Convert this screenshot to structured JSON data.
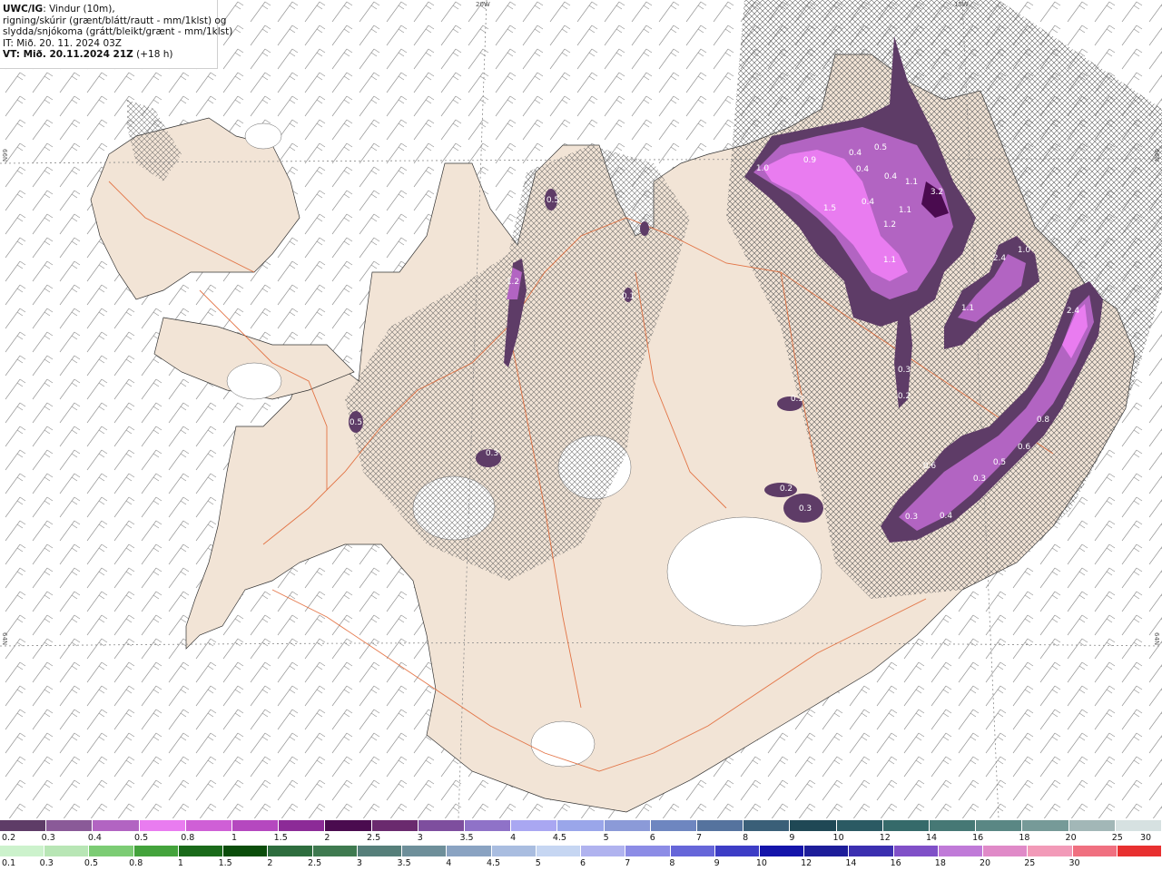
{
  "header": {
    "model": "UWC/IG",
    "line1_rest": ": Vindur (10m),",
    "line2": "rigning/skúrir (grænt/blátt/rautt - mm/1klst) og",
    "line3": "slydda/snjókoma (grátt/bleikt/grænt - mm/1klst)",
    "line4": "IT: Mið. 20. 11. 2024 03Z",
    "vt_label": "VT: Mið. 20.11.2024 21Z",
    "vt_rest": " (+18 h)"
  },
  "grid_labels": {
    "top_20w": "20W",
    "top_15w": "15W",
    "left_66n": "66N",
    "left_64n": "64N",
    "right_66n": "66N",
    "right_64n": "64N"
  },
  "precip_labels": [
    "1.0",
    "0.9",
    "0.4",
    "0.5",
    "0.4",
    "0.4",
    "1.1",
    "3.2",
    "1.5",
    "0.4",
    "1.2",
    "1.1",
    "1.1",
    "2.4",
    "1.0",
    "1.1",
    "2.4",
    "0.5",
    "1.2",
    "0.3",
    "0.2",
    "0.1",
    "0.3",
    "0.5",
    "0.3",
    "0.2",
    "0.3",
    "0.6",
    "0.8",
    "0.6",
    "0.3",
    "0.5",
    "0.3",
    "0.4"
  ],
  "colorbars": {
    "snow": {
      "labels": [
        "0.2",
        "0.3",
        "0.4",
        "0.5",
        "0.8",
        "1",
        "1.5",
        "2",
        "2.5",
        "3",
        "3.5",
        "4",
        "4.5",
        "5",
        "6",
        "7",
        "8",
        "9",
        "10",
        "12",
        "14",
        "16",
        "18",
        "20",
        "25",
        "30"
      ],
      "colors": [
        "#5e3c67",
        "#8a5a98",
        "#b264c2",
        "#e97cf0",
        "#cf5fd6",
        "#b548bf",
        "#8c2b97",
        "#4a0b4f",
        "#6a2a6e",
        "#7e4e9e",
        "#8f72c8",
        "#a9a7f2",
        "#9aa6ea",
        "#8b9ad8",
        "#6e86c0",
        "#55739e",
        "#3a5f78",
        "#1f4855",
        "#2b5a63",
        "#356a6a",
        "#467875",
        "#5a8784",
        "#769a98",
        "#a2b7b7",
        "#d6e1e1"
      ]
    },
    "rain": {
      "labels": [
        "0.1",
        "0.3",
        "0.5",
        "0.8",
        "1",
        "1.5",
        "2",
        "2.5",
        "3",
        "3.5",
        "4",
        "4.5",
        "5",
        "6",
        "7",
        "8",
        "9",
        "10",
        "12",
        "14",
        "16",
        "18",
        "20",
        "25",
        "30"
      ],
      "colors": [
        "#ccf2cc",
        "#b8e6b5",
        "#7ccc74",
        "#44a33c",
        "#1a6a1a",
        "#0b4d0b",
        "#2e6d3e",
        "#3f7a50",
        "#567f7a",
        "#6e8f9a",
        "#8aa3c2",
        "#a9bde0",
        "#c6d6f2",
        "#b0b3ef",
        "#8c8ce6",
        "#6666d9",
        "#3d3dc6",
        "#1414aa",
        "#1d1d9a",
        "#3b2fb0",
        "#8050c8",
        "#c07ad8",
        "#e08ac8",
        "#f29ab8",
        "#f07080",
        "#e83030"
      ]
    }
  }
}
